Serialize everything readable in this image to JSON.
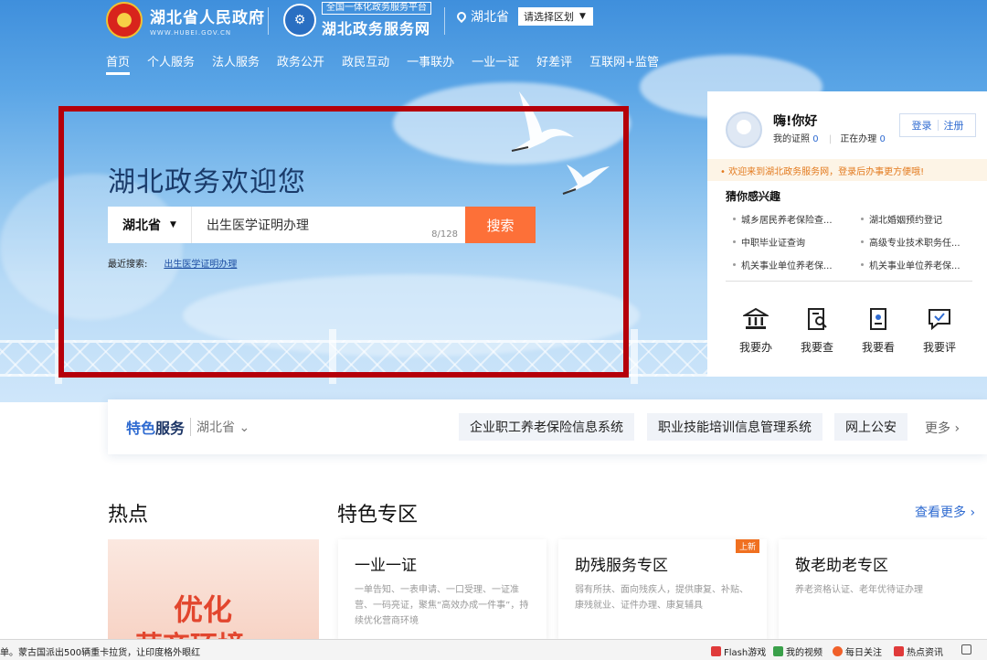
{
  "header": {
    "gov_name": "湖北省人民政府",
    "gov_sub": "WWW.HUBEI.GOV.CN",
    "platform_tag": "全国一体化政务服务平台",
    "platform_name": "湖北政务服务网",
    "region": "湖北省",
    "region_select": "请选择区划"
  },
  "nav": [
    "首页",
    "个人服务",
    "法人服务",
    "政务公开",
    "政民互动",
    "一事联办",
    "一业一证",
    "好差评",
    "互联网+监管"
  ],
  "hero": {
    "welcome": "湖北政务欢迎您",
    "search_region": "湖北省",
    "search_value": "出生医学证明办理",
    "search_count": "8/128",
    "search_button": "搜索",
    "recent_label": "最近搜索:",
    "recent_link": "出生医学证明办理"
  },
  "panel": {
    "greeting": "嗨!你好",
    "my_license_label": "我的证照",
    "my_license_count": "0",
    "in_progress_label": "正在办理",
    "in_progress_count": "0",
    "login": "登录",
    "register": "注册",
    "notice": "• 欢迎来到湖北政务服务网，登录后办事更方便哦!",
    "guess_title": "猜你感兴趣",
    "guess_items": [
      "城乡居民养老保险查...",
      "湖北婚姻预约登记",
      "中职毕业证查询",
      "高级专业技术职务任...",
      "机关事业单位养老保...",
      "机关事业单位养老保..."
    ],
    "quick": [
      "我要办",
      "我要查",
      "我要看",
      "我要评"
    ]
  },
  "services": {
    "title_a": "特色",
    "title_b": "服务",
    "region": "湖北省",
    "chips": [
      "企业职工养老保险信息系统",
      "职业技能培训信息管理系统",
      "网上公安"
    ],
    "more": "更多 ›"
  },
  "sections": {
    "hot": "热点",
    "featured": "特色专区",
    "see_more": "查看更多 ›",
    "hot_text_1": "优化",
    "hot_text_2": "营商环境"
  },
  "cards": [
    {
      "title": "一业一证",
      "desc": "一单告知、一表申请、一口受理、一证准营、一码亮证，聚焦“高效办成一件事”，持续优化营商环境",
      "badge": ""
    },
    {
      "title": "助残服务专区",
      "desc": "弱有所扶、面向残疾人，提供康复、补贴、康残就业、证件办理、康复辅具",
      "badge": "上新"
    },
    {
      "title": "敬老助老专区",
      "desc": "养老资格认证、老年优待证办理",
      "badge": ""
    }
  ],
  "statusbar": {
    "news": "单。蒙古国派出500辆重卡拉货，让印度格外眼红",
    "items": [
      "Flash游戏",
      "我的视频",
      "每日关注",
      "热点资讯"
    ]
  },
  "colors": {
    "accent": "#2f6bd1",
    "search_button": "#fd7038",
    "frame": "#b5000a",
    "notice": "#e37a1e"
  }
}
